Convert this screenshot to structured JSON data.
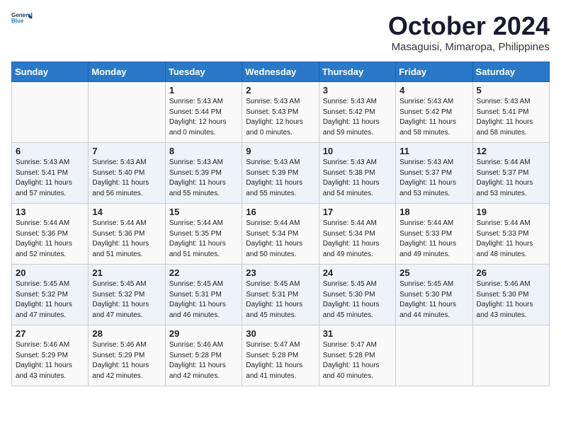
{
  "header": {
    "logo_general": "General",
    "logo_blue": "Blue",
    "month": "October 2024",
    "location": "Masaguisi, Mimaropa, Philippines"
  },
  "columns": [
    "Sunday",
    "Monday",
    "Tuesday",
    "Wednesday",
    "Thursday",
    "Friday",
    "Saturday"
  ],
  "weeks": [
    [
      {
        "day": "",
        "info": ""
      },
      {
        "day": "",
        "info": ""
      },
      {
        "day": "1",
        "info": "Sunrise: 5:43 AM\nSunset: 5:44 PM\nDaylight: 12 hours\nand 0 minutes."
      },
      {
        "day": "2",
        "info": "Sunrise: 5:43 AM\nSunset: 5:43 PM\nDaylight: 12 hours\nand 0 minutes."
      },
      {
        "day": "3",
        "info": "Sunrise: 5:43 AM\nSunset: 5:42 PM\nDaylight: 11 hours\nand 59 minutes."
      },
      {
        "day": "4",
        "info": "Sunrise: 5:43 AM\nSunset: 5:42 PM\nDaylight: 11 hours\nand 58 minutes."
      },
      {
        "day": "5",
        "info": "Sunrise: 5:43 AM\nSunset: 5:41 PM\nDaylight: 11 hours\nand 58 minutes."
      }
    ],
    [
      {
        "day": "6",
        "info": "Sunrise: 5:43 AM\nSunset: 5:41 PM\nDaylight: 11 hours\nand 57 minutes."
      },
      {
        "day": "7",
        "info": "Sunrise: 5:43 AM\nSunset: 5:40 PM\nDaylight: 11 hours\nand 56 minutes."
      },
      {
        "day": "8",
        "info": "Sunrise: 5:43 AM\nSunset: 5:39 PM\nDaylight: 11 hours\nand 55 minutes."
      },
      {
        "day": "9",
        "info": "Sunrise: 5:43 AM\nSunset: 5:39 PM\nDaylight: 11 hours\nand 55 minutes."
      },
      {
        "day": "10",
        "info": "Sunrise: 5:43 AM\nSunset: 5:38 PM\nDaylight: 11 hours\nand 54 minutes."
      },
      {
        "day": "11",
        "info": "Sunrise: 5:43 AM\nSunset: 5:37 PM\nDaylight: 11 hours\nand 53 minutes."
      },
      {
        "day": "12",
        "info": "Sunrise: 5:44 AM\nSunset: 5:37 PM\nDaylight: 11 hours\nand 53 minutes."
      }
    ],
    [
      {
        "day": "13",
        "info": "Sunrise: 5:44 AM\nSunset: 5:36 PM\nDaylight: 11 hours\nand 52 minutes."
      },
      {
        "day": "14",
        "info": "Sunrise: 5:44 AM\nSunset: 5:36 PM\nDaylight: 11 hours\nand 51 minutes."
      },
      {
        "day": "15",
        "info": "Sunrise: 5:44 AM\nSunset: 5:35 PM\nDaylight: 11 hours\nand 51 minutes."
      },
      {
        "day": "16",
        "info": "Sunrise: 5:44 AM\nSunset: 5:34 PM\nDaylight: 11 hours\nand 50 minutes."
      },
      {
        "day": "17",
        "info": "Sunrise: 5:44 AM\nSunset: 5:34 PM\nDaylight: 11 hours\nand 49 minutes."
      },
      {
        "day": "18",
        "info": "Sunrise: 5:44 AM\nSunset: 5:33 PM\nDaylight: 11 hours\nand 49 minutes."
      },
      {
        "day": "19",
        "info": "Sunrise: 5:44 AM\nSunset: 5:33 PM\nDaylight: 11 hours\nand 48 minutes."
      }
    ],
    [
      {
        "day": "20",
        "info": "Sunrise: 5:45 AM\nSunset: 5:32 PM\nDaylight: 11 hours\nand 47 minutes."
      },
      {
        "day": "21",
        "info": "Sunrise: 5:45 AM\nSunset: 5:32 PM\nDaylight: 11 hours\nand 47 minutes."
      },
      {
        "day": "22",
        "info": "Sunrise: 5:45 AM\nSunset: 5:31 PM\nDaylight: 11 hours\nand 46 minutes."
      },
      {
        "day": "23",
        "info": "Sunrise: 5:45 AM\nSunset: 5:31 PM\nDaylight: 11 hours\nand 45 minutes."
      },
      {
        "day": "24",
        "info": "Sunrise: 5:45 AM\nSunset: 5:30 PM\nDaylight: 11 hours\nand 45 minutes."
      },
      {
        "day": "25",
        "info": "Sunrise: 5:45 AM\nSunset: 5:30 PM\nDaylight: 11 hours\nand 44 minutes."
      },
      {
        "day": "26",
        "info": "Sunrise: 5:46 AM\nSunset: 5:30 PM\nDaylight: 11 hours\nand 43 minutes."
      }
    ],
    [
      {
        "day": "27",
        "info": "Sunrise: 5:46 AM\nSunset: 5:29 PM\nDaylight: 11 hours\nand 43 minutes."
      },
      {
        "day": "28",
        "info": "Sunrise: 5:46 AM\nSunset: 5:29 PM\nDaylight: 11 hours\nand 42 minutes."
      },
      {
        "day": "29",
        "info": "Sunrise: 5:46 AM\nSunset: 5:28 PM\nDaylight: 11 hours\nand 42 minutes."
      },
      {
        "day": "30",
        "info": "Sunrise: 5:47 AM\nSunset: 5:28 PM\nDaylight: 11 hours\nand 41 minutes."
      },
      {
        "day": "31",
        "info": "Sunrise: 5:47 AM\nSunset: 5:28 PM\nDaylight: 11 hours\nand 40 minutes."
      },
      {
        "day": "",
        "info": ""
      },
      {
        "day": "",
        "info": ""
      }
    ]
  ]
}
